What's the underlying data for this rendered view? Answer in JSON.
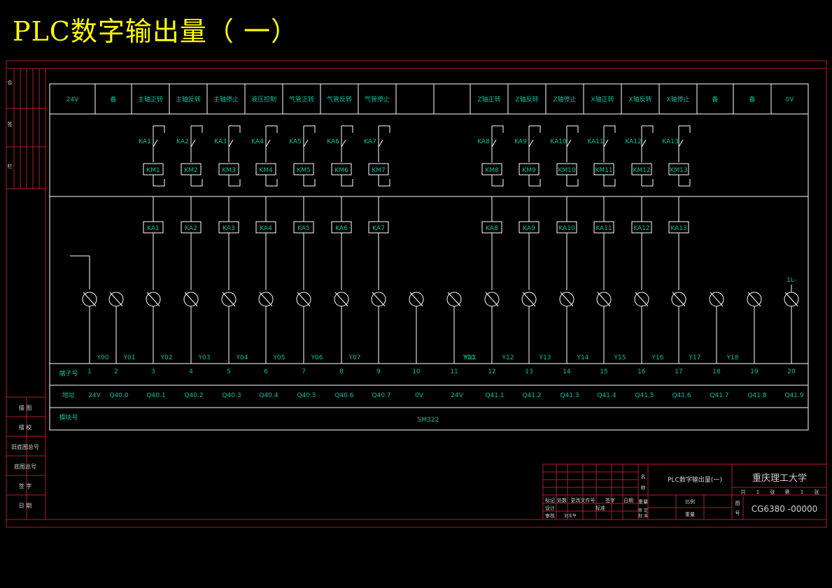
{
  "title": "PLC数字输出量（ 一）",
  "header_cells": [
    "24V",
    "备",
    "主轴正转",
    "主轴反转",
    "主轴停止",
    "液压控制",
    "气管正转",
    "气管反转",
    "气管停止",
    "",
    "",
    "Z轴正转",
    "Z轴反转",
    "Z轴停止",
    "X轴正转",
    "X轴反转",
    "X轴停止",
    "备",
    "备",
    "0V"
  ],
  "relays": [
    {
      "ka": "KA1",
      "km": "KM1",
      "n": "1"
    },
    {
      "ka": "KA2",
      "km": "KM2",
      "n": "2"
    },
    {
      "ka": "KA3",
      "km": "KM3",
      "n": "3"
    },
    {
      "ka": "KA4",
      "km": "KM4",
      "n": "4"
    },
    {
      "ka": "KA5",
      "km": "KM5",
      "n": "5"
    },
    {
      "ka": "KA6",
      "km": "KM6",
      "n": "6"
    },
    {
      "ka": "KA7",
      "km": "KM7",
      "n": "7"
    },
    {
      "ka": "KA8",
      "km": "KM8",
      "n": "8"
    },
    {
      "ka": "KA9",
      "km": "KM9",
      "n": "9"
    },
    {
      "ka": "KA10",
      "km": "KM10",
      "n": "10"
    },
    {
      "ka": "KA11",
      "km": "KM11",
      "n": "11"
    },
    {
      "ka": "KA12",
      "km": "KM12",
      "n": "12"
    },
    {
      "ka": "KA13",
      "km": "KM13",
      "n": "13"
    }
  ],
  "y_labels": [
    "Y00",
    "Y01",
    "Y02",
    "Y03",
    "Y04",
    "Y05",
    "Y06",
    "Y07",
    "Y10",
    "Y11",
    "Y12",
    "Y13",
    "Y14",
    "Y15",
    "Y16",
    "Y17",
    "Y18"
  ],
  "terminal_label": "1L-",
  "row_labels": {
    "terminal": "端子号",
    "address": "地址",
    "module": "模块号"
  },
  "terminal_numbers": [
    "1",
    "2",
    "3",
    "4",
    "5",
    "6",
    "7",
    "8",
    "9",
    "10",
    "11",
    "12",
    "13",
    "14",
    "15",
    "16",
    "17",
    "18",
    "19",
    "20"
  ],
  "addresses": [
    "24V",
    "Q40.0",
    "Q40.1",
    "Q40.2",
    "Q40.3",
    "Q40.4",
    "Q40.5",
    "Q40.6",
    "Q40.7",
    "0V",
    "24V",
    "Q41.1",
    "Q41.2",
    "Q41.3",
    "Q41.4",
    "Q41.5",
    "Q41.6",
    "Q41.7",
    "Q41.8",
    "Q41.9"
  ],
  "module": "SM322",
  "left_strip": [
    "描 图",
    "描 校",
    "旧底图总号",
    "底图总号",
    "签 字",
    "日 期"
  ],
  "left_top_strip": [
    "会",
    "签",
    "栏"
  ],
  "title_block": {
    "drawing_name": "PLC数字输出量(一)",
    "university": "重庆理工大学",
    "code": "CG6380 -00000",
    "name_label": "名 称",
    "code_label": "图 号",
    "sheet": [
      "共",
      "1",
      "张",
      "第",
      "1",
      "张"
    ],
    "row1": [
      "标记",
      "处数",
      "更改文件号",
      "签字",
      "日期"
    ],
    "designer": [
      "设计",
      "审核"
    ],
    "designer_name": "刘玉平",
    "labels": [
      "标准",
      "重量",
      "比例",
      "重量"
    ],
    "zoom_cells": [
      "审 定",
      "批 准"
    ]
  },
  "colors": {
    "frame": "#b01c2a",
    "line": "#ffffff",
    "label": "#00c0a0",
    "title": "#ffff00"
  }
}
